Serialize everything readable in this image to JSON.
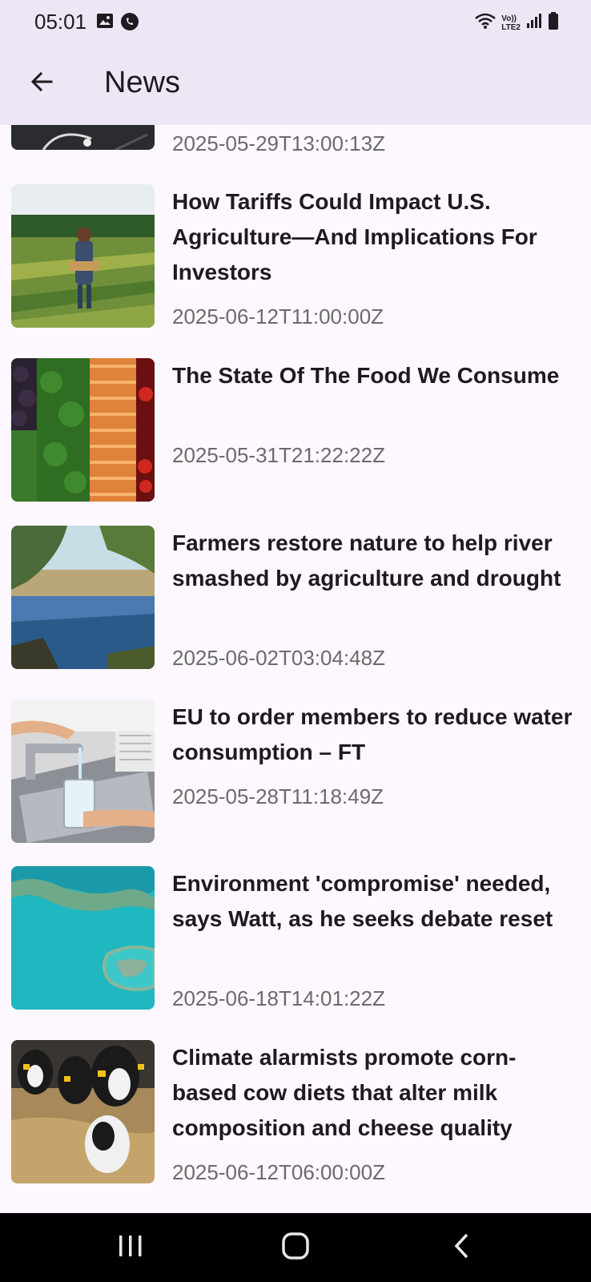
{
  "status_bar": {
    "time": "05:01",
    "network_label": "LTE2",
    "volte_label": "Vo))"
  },
  "app_bar": {
    "title": "News",
    "back_icon": "arrow-back-icon"
  },
  "news": [
    {
      "title": "",
      "timestamp": "2025-05-29T13:00:13Z",
      "thumbnail": "partial-dark-image"
    },
    {
      "title": "How Tariffs Could Impact U.S. Agriculture—And Implications For Investors",
      "timestamp": "2025-06-12T11:00:00Z",
      "thumbnail": "farmer-field-image"
    },
    {
      "title": "The State Of The Food We Consume",
      "timestamp": "2025-05-31T21:22:22Z",
      "thumbnail": "vegetables-image"
    },
    {
      "title": "Farmers restore nature to help river smashed by agriculture and drought",
      "timestamp": "2025-06-02T03:04:48Z",
      "thumbnail": "river-image"
    },
    {
      "title": "EU to order members to reduce water consumption – FT",
      "timestamp": "2025-05-28T11:18:49Z",
      "thumbnail": "water-tap-image"
    },
    {
      "title": "Environment 'compromise' needed, says Watt, as he seeks debate reset",
      "timestamp": "2025-06-18T14:01:22Z",
      "thumbnail": "reef-image"
    },
    {
      "title": "Climate alarmists promote corn-based cow diets that alter milk composition and cheese quality",
      "timestamp": "2025-06-12T06:00:00Z",
      "thumbnail": "cows-image"
    }
  ],
  "nav_bar": {
    "recents_icon": "recents-icon",
    "home_icon": "home-icon",
    "back_icon": "back-chevron-icon"
  }
}
